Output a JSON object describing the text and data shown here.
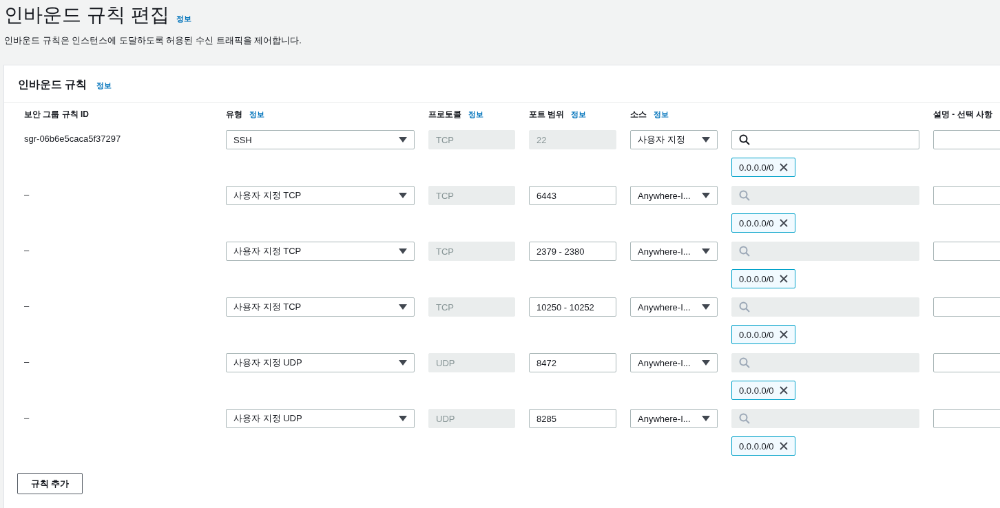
{
  "page": {
    "title": "인바운드 규칙 편집",
    "info_link": "정보",
    "description": "인바운드 규칙은 인스턴스에 도달하도록 허용된 수신 트래픽을 제어합니다."
  },
  "panel": {
    "title": "인바운드 규칙",
    "info_link": "정보",
    "columns": [
      {
        "label": "보안 그룹 규칙 ID"
      },
      {
        "label": "유형",
        "info_link": "정보"
      },
      {
        "label": "프로토콜",
        "info_link": "정보"
      },
      {
        "label": "포트 범위",
        "info_link": "정보"
      },
      {
        "label": "소스",
        "info_link": "정보"
      },
      {
        "label": "설명 - 선택 사항"
      }
    ],
    "rows": [
      {
        "rule_id": "sgr-06b6e5caca5f37297",
        "type": "SSH",
        "protocol": "TCP",
        "port": "22",
        "port_disabled": true,
        "source": "사용자 지정",
        "search_disabled": false,
        "cidr": "0.0.0.0/0"
      },
      {
        "rule_id": "–",
        "type": "사용자 지정 TCP",
        "protocol": "TCP",
        "port": "6443",
        "port_disabled": false,
        "source": "Anywhere-I...",
        "search_disabled": true,
        "cidr": "0.0.0.0/0"
      },
      {
        "rule_id": "–",
        "type": "사용자 지정 TCP",
        "protocol": "TCP",
        "port": "2379 - 2380",
        "port_disabled": false,
        "source": "Anywhere-I...",
        "search_disabled": true,
        "cidr": "0.0.0.0/0"
      },
      {
        "rule_id": "–",
        "type": "사용자 지정 TCP",
        "protocol": "TCP",
        "port": "10250 - 10252",
        "port_disabled": false,
        "source": "Anywhere-I...",
        "search_disabled": true,
        "cidr": "0.0.0.0/0"
      },
      {
        "rule_id": "–",
        "type": "사용자 지정 UDP",
        "protocol": "UDP",
        "port": "8472",
        "port_disabled": false,
        "source": "Anywhere-I...",
        "search_disabled": true,
        "cidr": "0.0.0.0/0"
      },
      {
        "rule_id": "–",
        "type": "사용자 지정 UDP",
        "protocol": "UDP",
        "port": "8285",
        "port_disabled": false,
        "source": "Anywhere-I...",
        "search_disabled": true,
        "cidr": "0.0.0.0/0"
      }
    ],
    "add_button": "규칙 추가"
  }
}
